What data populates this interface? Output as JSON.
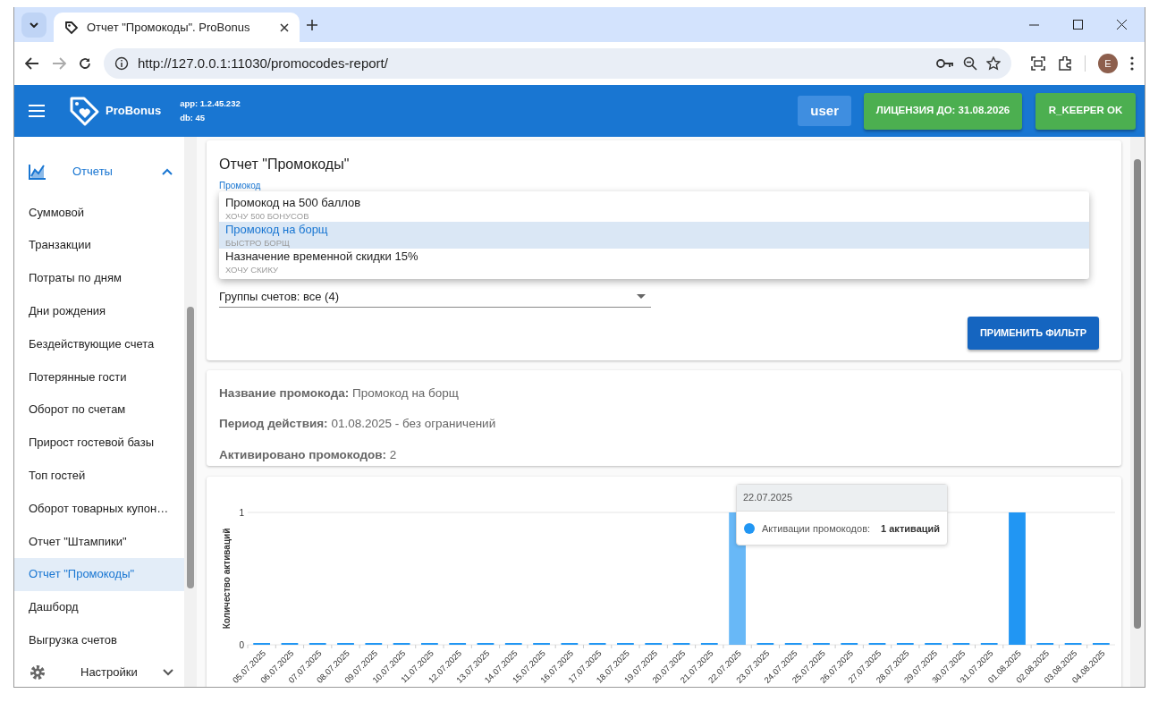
{
  "browser": {
    "tab_title": "Отчет \"Промокоды\". ProBonus",
    "url": "http://127.0.0.1:11030/promocodes-report/",
    "profile_initial": "E"
  },
  "header": {
    "brand": "ProBonus",
    "app_version": "app: 1.2.45.232",
    "db_version": "db: 45",
    "user": "user",
    "license_button": "ЛИЦЕНЗИЯ ДО: 31.08.2026",
    "keeper_button": "R_KEEPER OK"
  },
  "sidebar": {
    "section": {
      "label": "Отчеты",
      "expanded": true
    },
    "items": [
      {
        "label": "Суммовой",
        "selected": false
      },
      {
        "label": "Транзакции",
        "selected": false
      },
      {
        "label": "Потраты по дням",
        "selected": false
      },
      {
        "label": "Дни рождения",
        "selected": false
      },
      {
        "label": "Бездействующие счета",
        "selected": false
      },
      {
        "label": "Потерянные гости",
        "selected": false
      },
      {
        "label": "Оборот по счетам",
        "selected": false
      },
      {
        "label": "Прирост гостевой базы",
        "selected": false
      },
      {
        "label": "Топ гостей",
        "selected": false
      },
      {
        "label": "Оборот товарных купон…",
        "selected": false
      },
      {
        "label": "Отчет \"Штампики\"",
        "selected": false
      },
      {
        "label": "Отчет \"Промокоды\"",
        "selected": true
      },
      {
        "label": "Дашборд",
        "selected": false
      },
      {
        "label": "Выгрузка счетов",
        "selected": false
      }
    ],
    "footer_section": {
      "label": "Настройки",
      "expanded": false
    }
  },
  "filter": {
    "title": "Отчет \"Промокоды\"",
    "promo_label": "Промокод",
    "options": [
      {
        "title": "Промокод на 500 баллов",
        "code": "ХОЧУ 500 БОНУСОВ",
        "selected": false
      },
      {
        "title": "Промокод на борщ",
        "code": "БЫСТРО БОРЩ",
        "selected": true
      },
      {
        "title": "Назначение временной скидки 15%",
        "code": "ХОЧУ СКИКУ",
        "selected": false
      }
    ],
    "group_value": "Группы счетов: все (4)",
    "apply_button": "ПРИМЕНИТЬ ФИЛЬТР"
  },
  "summary": [
    {
      "label": "Название промокода:",
      "value": "Промокод на борщ"
    },
    {
      "label": "Период действия:",
      "value": "01.08.2025 - без ограничений"
    },
    {
      "label": "Активировано промокодов:",
      "value": "2"
    }
  ],
  "chart": {
    "chart_data": {
      "type": "bar",
      "ylabel": "Количество активаций",
      "categories": [
        "05.07.2025",
        "06.07.2025",
        "07.07.2025",
        "08.07.2025",
        "09.07.2025",
        "10.07.2025",
        "11.07.2025",
        "12.07.2025",
        "13.07.2025",
        "14.07.2025",
        "15.07.2025",
        "16.07.2025",
        "17.07.2025",
        "18.07.2025",
        "19.07.2025",
        "20.07.2025",
        "21.07.2025",
        "22.07.2025",
        "23.07.2025",
        "24.07.2025",
        "25.07.2025",
        "26.07.2025",
        "27.07.2025",
        "28.07.2025",
        "29.07.2025",
        "30.07.2025",
        "31.07.2025",
        "01.08.2025",
        "02.08.2025",
        "03.08.2025",
        "04.08.2025"
      ],
      "series": [
        {
          "name": "Активации промокодов",
          "color": "#2196f3",
          "values": [
            0,
            0,
            0,
            0,
            0,
            0,
            0,
            0,
            0,
            0,
            0,
            0,
            0,
            0,
            0,
            0,
            0,
            1,
            0,
            0,
            0,
            0,
            0,
            0,
            0,
            0,
            0,
            1,
            0,
            0,
            0
          ]
        }
      ],
      "ylim": [
        0,
        1
      ],
      "yticks": [
        0,
        1
      ]
    },
    "tooltip": {
      "title": "22.07.2025",
      "separator": ":",
      "value": "1 активаций"
    }
  }
}
